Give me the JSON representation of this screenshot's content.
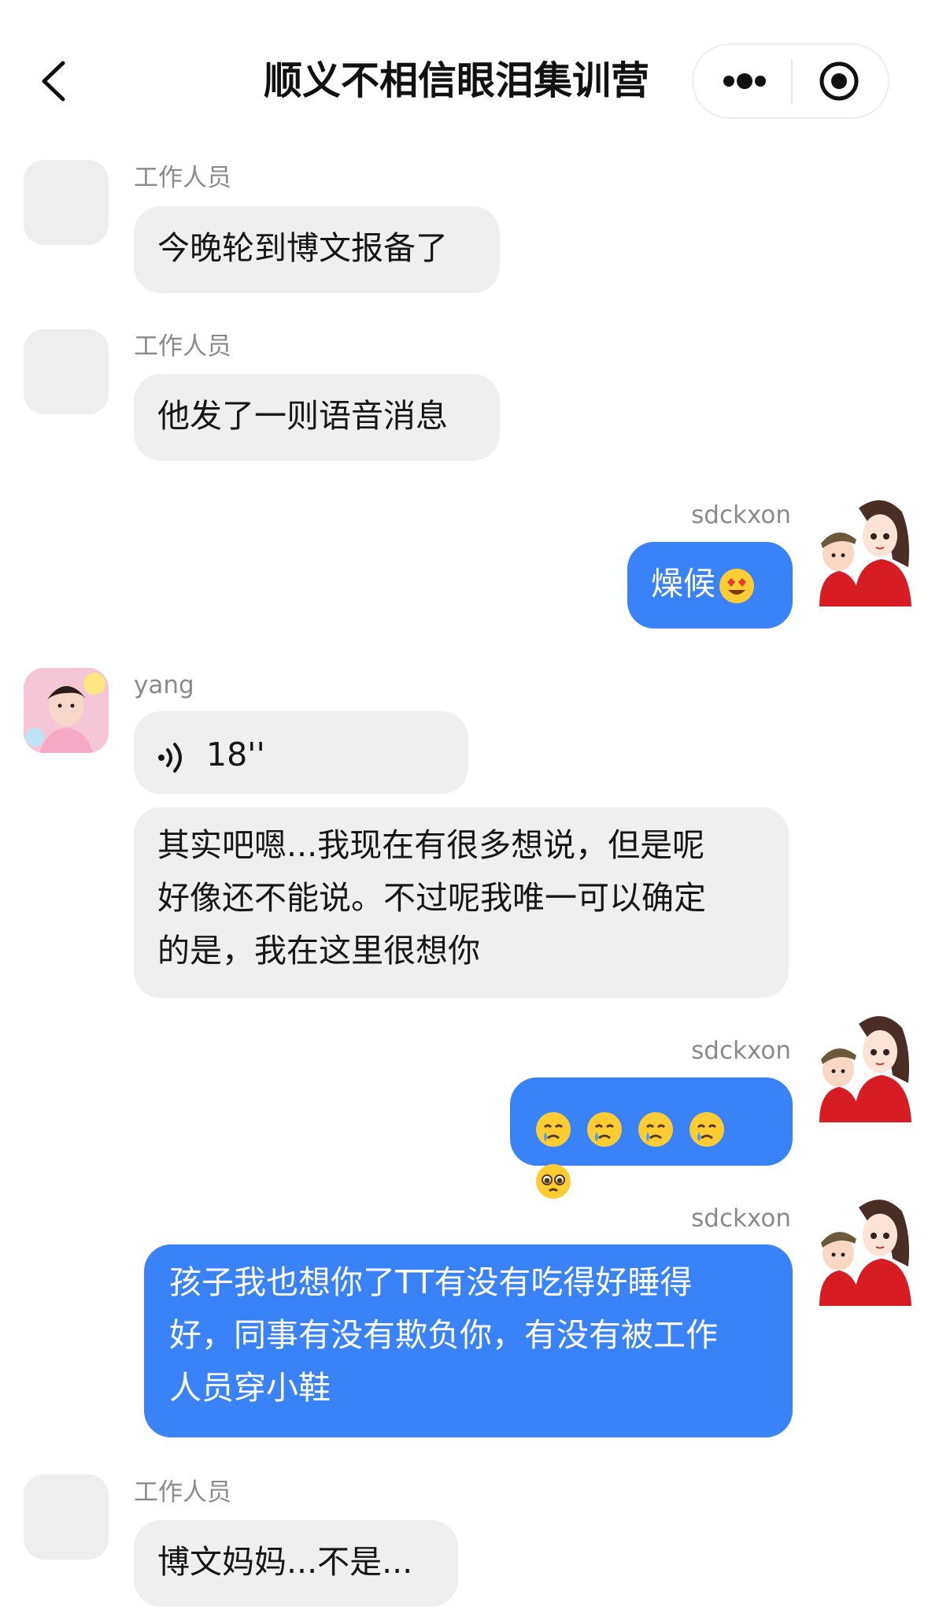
{
  "header": {
    "title": "顺义不相信眼泪集训营",
    "back_icon": "chevron-left-icon",
    "more_icon": "more-dots-icon",
    "target_icon": "record-target-icon"
  },
  "messages": [
    {
      "side": "left",
      "sender": "工作人员",
      "text": "今晚轮到博文报备了"
    },
    {
      "side": "left",
      "sender": "工作人员",
      "text": "他发了一则语音消息"
    },
    {
      "side": "right",
      "sender": "sdckxon",
      "text": "燥候",
      "emoji": "heart-eyes-emoji"
    },
    {
      "side": "left",
      "sender": "yang",
      "voice_length": "18''"
    },
    {
      "side": "left",
      "text_lines": [
        "其实吧嗯...我现在有很多想说，但是呢",
        "好像还不能说。不过呢我唯一可以确定",
        "的是，我在这里很想你"
      ]
    },
    {
      "side": "right",
      "sender": "sdckxon",
      "emojis": [
        "crying-face-emoji",
        "crying-face-emoji",
        "crying-face-emoji",
        "crying-face-emoji",
        "pleading-face-emoji"
      ]
    },
    {
      "side": "right",
      "sender": "sdckxon",
      "text_lines": [
        "孩子我也想你了TT有没有吃得好睡得",
        "好，同事有没有欺负你，有没有被工作",
        "人员穿小鞋"
      ]
    },
    {
      "side": "left",
      "sender": "工作人员",
      "text": "博文妈妈...不是..."
    }
  ],
  "colors": {
    "accent_blue": "#3a82f7",
    "bubble_gray": "#efefef",
    "sender_gray": "#8b8b8b"
  }
}
